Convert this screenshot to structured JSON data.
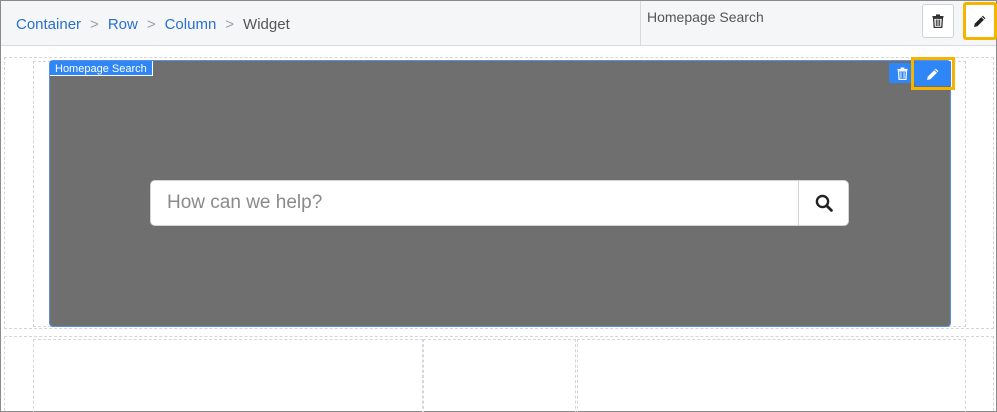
{
  "breadcrumb": {
    "items": [
      "Container",
      "Row",
      "Column"
    ],
    "separator": ">",
    "current": "Widget"
  },
  "toolbar": {
    "widget_name": "Homepage Search",
    "delete_icon": "trash-icon",
    "edit_icon": "pencil-icon"
  },
  "widget": {
    "tag_label": "Homepage Search",
    "background": "#6f6f6f",
    "accent": "#2f86f6",
    "highlight": "#f4b400",
    "search": {
      "placeholder": "How can we help?",
      "button_icon": "search-icon"
    }
  }
}
